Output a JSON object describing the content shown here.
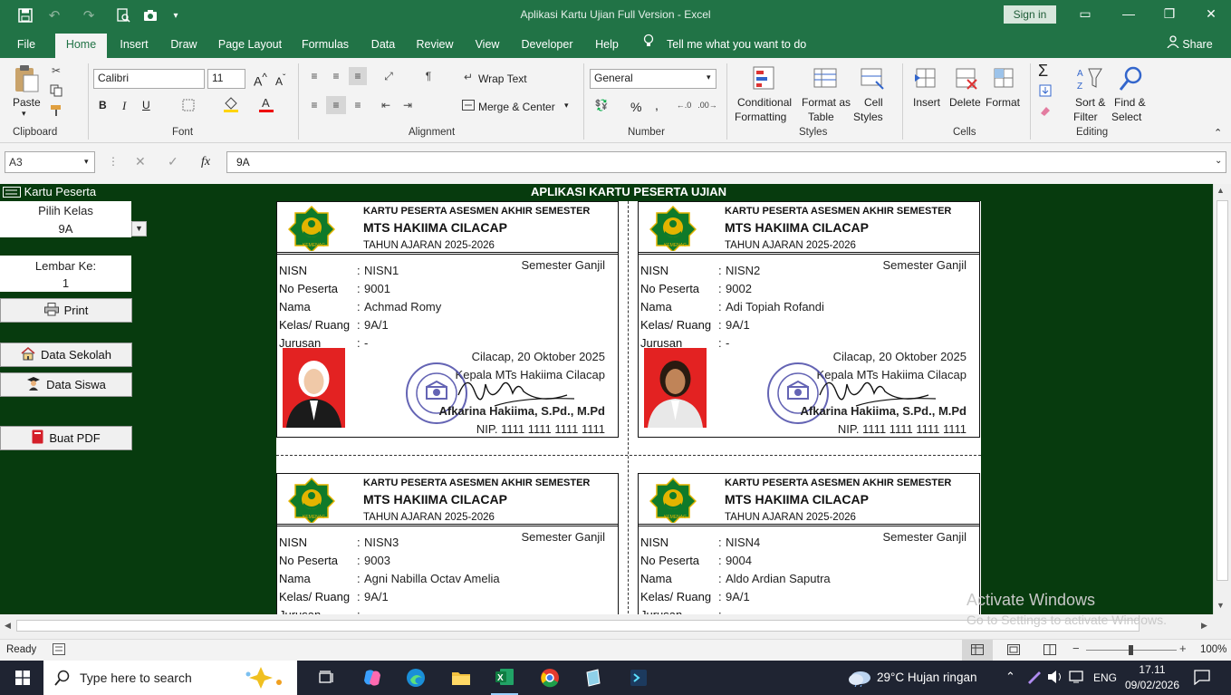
{
  "window": {
    "title": "Aplikasi Kartu Ujian Full Version  -  Excel",
    "signin": "Sign in"
  },
  "tabs": [
    "File",
    "Home",
    "Insert",
    "Draw",
    "Page Layout",
    "Formulas",
    "Data",
    "Review",
    "View",
    "Developer",
    "Help"
  ],
  "tell_me": "Tell me what you want to do",
  "share": "Share",
  "ribbon": {
    "clipboard": {
      "paste": "Paste",
      "label": "Clipboard"
    },
    "font": {
      "name": "Calibri",
      "size": "11",
      "label": "Font",
      "bold": "B",
      "italic": "I",
      "underline": "U"
    },
    "alignment": {
      "wrap": "Wrap Text",
      "merge": "Merge & Center",
      "label": "Alignment"
    },
    "number": {
      "format": "General",
      "percent": "%",
      "comma": ",",
      "label": "Number"
    },
    "styles": {
      "conditional1": "Conditional",
      "conditional2": "Formatting",
      "format_as1": "Format as",
      "format_as2": "Table",
      "cell1": "Cell",
      "cell2": "Styles",
      "label": "Styles"
    },
    "cells": {
      "insert": "Insert",
      "delete": "Delete",
      "format": "Format",
      "label": "Cells"
    },
    "editing": {
      "sort1": "Sort &",
      "sort2": "Filter",
      "find1": "Find &",
      "find2": "Select",
      "label": "Editing"
    }
  },
  "formula_bar": {
    "name_box": "A3",
    "fx": "fx",
    "value": "9A"
  },
  "panel": {
    "title": "Kartu Peserta",
    "pilih_label": "Pilih Kelas",
    "pilih_value": "9A",
    "lembar_label": "Lembar Ke:",
    "lembar_value": "1",
    "print": "Print",
    "data_sekolah": "Data Sekolah",
    "data_siswa": "Data Siswa",
    "buat_pdf": "Buat PDF"
  },
  "heading": "APLIKASI KARTU PESERTA UJIAN",
  "card_common": {
    "h1": "KARTU PESERTA ASESMEN AKHIR SEMESTER",
    "h2": "MTS HAKIIMA CILACAP",
    "h3": "TAHUN AJARAN 2025-2026",
    "l_nisn": "NISN",
    "l_nopeserta": "No Peserta",
    "l_nama": "Nama",
    "l_kelas": "Kelas/ Ruang",
    "l_jurusan": "Jurusan",
    "colon": ":",
    "semester": "Semester Ganjil",
    "place_date": "Cilacap, 20 Oktober 2025",
    "role": "Kepala MTs Hakiima Cilacap",
    "head_name": "Afkarina Hakiima, S.Pd., M.Pd",
    "nip": "NIP. 1111 1111 1111 1111"
  },
  "cards": [
    {
      "nisn": "NISN1",
      "nopeserta": "9001",
      "nama": "Achmad Romy",
      "kelas": "9A/1",
      "jurusan": "-"
    },
    {
      "nisn": "NISN2",
      "nopeserta": "9002",
      "nama": "Adi Topiah Rofandi",
      "kelas": "9A/1",
      "jurusan": "-"
    },
    {
      "nisn": "NISN3",
      "nopeserta": "9003",
      "nama": "Agni Nabilla Octav Amelia",
      "kelas": "9A/1",
      "jurusan": "-"
    },
    {
      "nisn": "NISN4",
      "nopeserta": "9004",
      "nama": "Aldo Ardian Saputra",
      "kelas": "9A/1",
      "jurusan": "-"
    }
  ],
  "watermark": {
    "line1": "Activate Windows",
    "line2": "Go to Settings to activate Windows."
  },
  "status": {
    "ready": "Ready",
    "zoom": "100%"
  },
  "taskbar": {
    "search": "Type here to search",
    "weather": "29°C  Hujan ringan",
    "lang": "ENG",
    "time": "17.11",
    "date": "09/02/2026"
  },
  "colors": {
    "excel_green": "#217346",
    "sheet_bg": "#073b0e",
    "logo_green": "#0f7a2a",
    "logo_gold": "#e3b400"
  }
}
